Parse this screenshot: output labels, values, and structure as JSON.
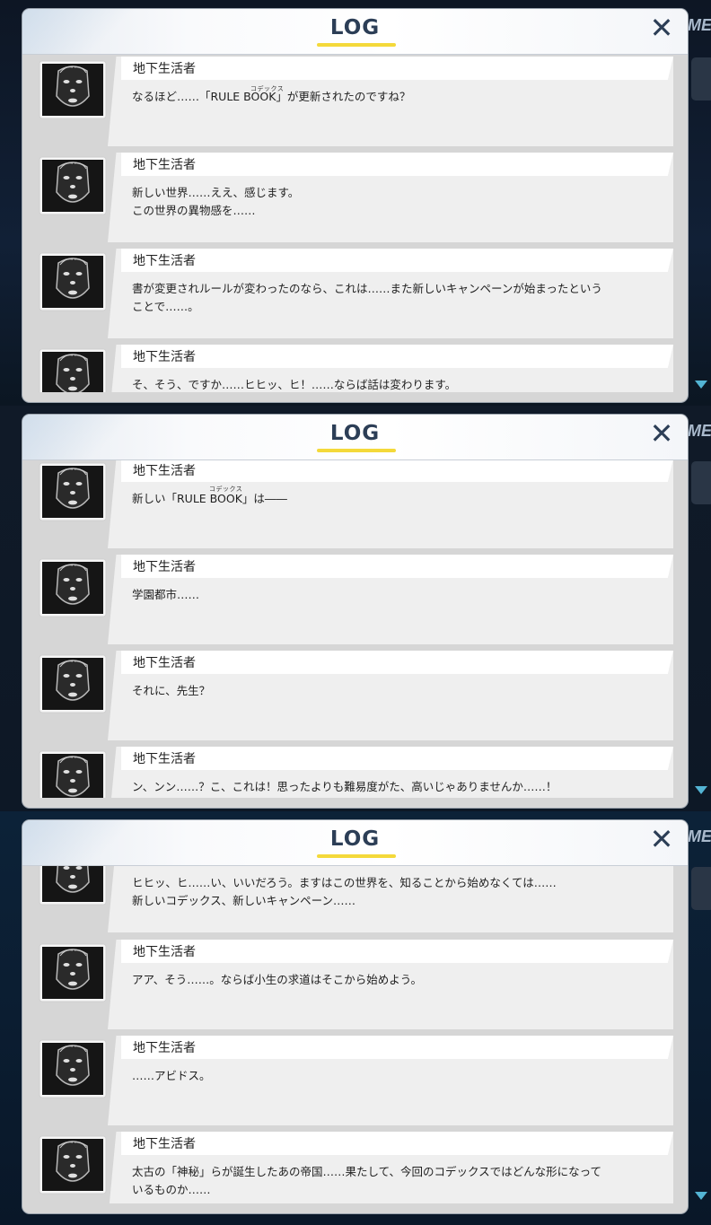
{
  "side_tab_label": "ME",
  "panels": [
    {
      "title": "LOG",
      "close_icon": "✕",
      "entries": [
        {
          "speaker": "地下生活者",
          "message": "なるほど……「RULE BOOK」が更新されたのですね？",
          "ruby": "コデックス"
        },
        {
          "speaker": "地下生活者",
          "message": "新しい世界……ええ、感じます。\nこの世界の異物感を……"
        },
        {
          "speaker": "地下生活者",
          "message": "書が変更されルールが変わったのなら、これは……また新しいキャンペーンが始まったという\nことで……。"
        },
        {
          "speaker": "地下生活者",
          "message": "そ、そう、ですか……ヒヒッ、ヒ！……ならば話は変わります。"
        }
      ]
    },
    {
      "title": "LOG",
      "close_icon": "✕",
      "entries": [
        {
          "speaker": "地下生活者",
          "message": "新しい「RULE BOOK」は――",
          "ruby": "コデックス"
        },
        {
          "speaker": "地下生活者",
          "message": "学園都市……"
        },
        {
          "speaker": "地下生活者",
          "message": "それに、先生？"
        },
        {
          "speaker": "地下生活者",
          "message": "ン、ンン……？こ、これは！思ったよりも難易度がた、高いじゃありませんか……！"
        }
      ]
    },
    {
      "title": "LOG",
      "close_icon": "✕",
      "entries": [
        {
          "speaker": "",
          "message": "ヒヒッ、ヒ……い、いいだろう。ますはこの世界を、知ることから始めなくては……\n新しいコデックス、新しいキャンペーン……"
        },
        {
          "speaker": "地下生活者",
          "message": "アア、そう……。ならば小生の求道はそこから始めよう。"
        },
        {
          "speaker": "地下生活者",
          "message": "……アビドス。"
        },
        {
          "speaker": "地下生活者",
          "message": "太古の「神秘」らが誕生したあの帝国……果たして、今回のコデックスではどんな形になって\nいるものか……"
        }
      ]
    }
  ]
}
